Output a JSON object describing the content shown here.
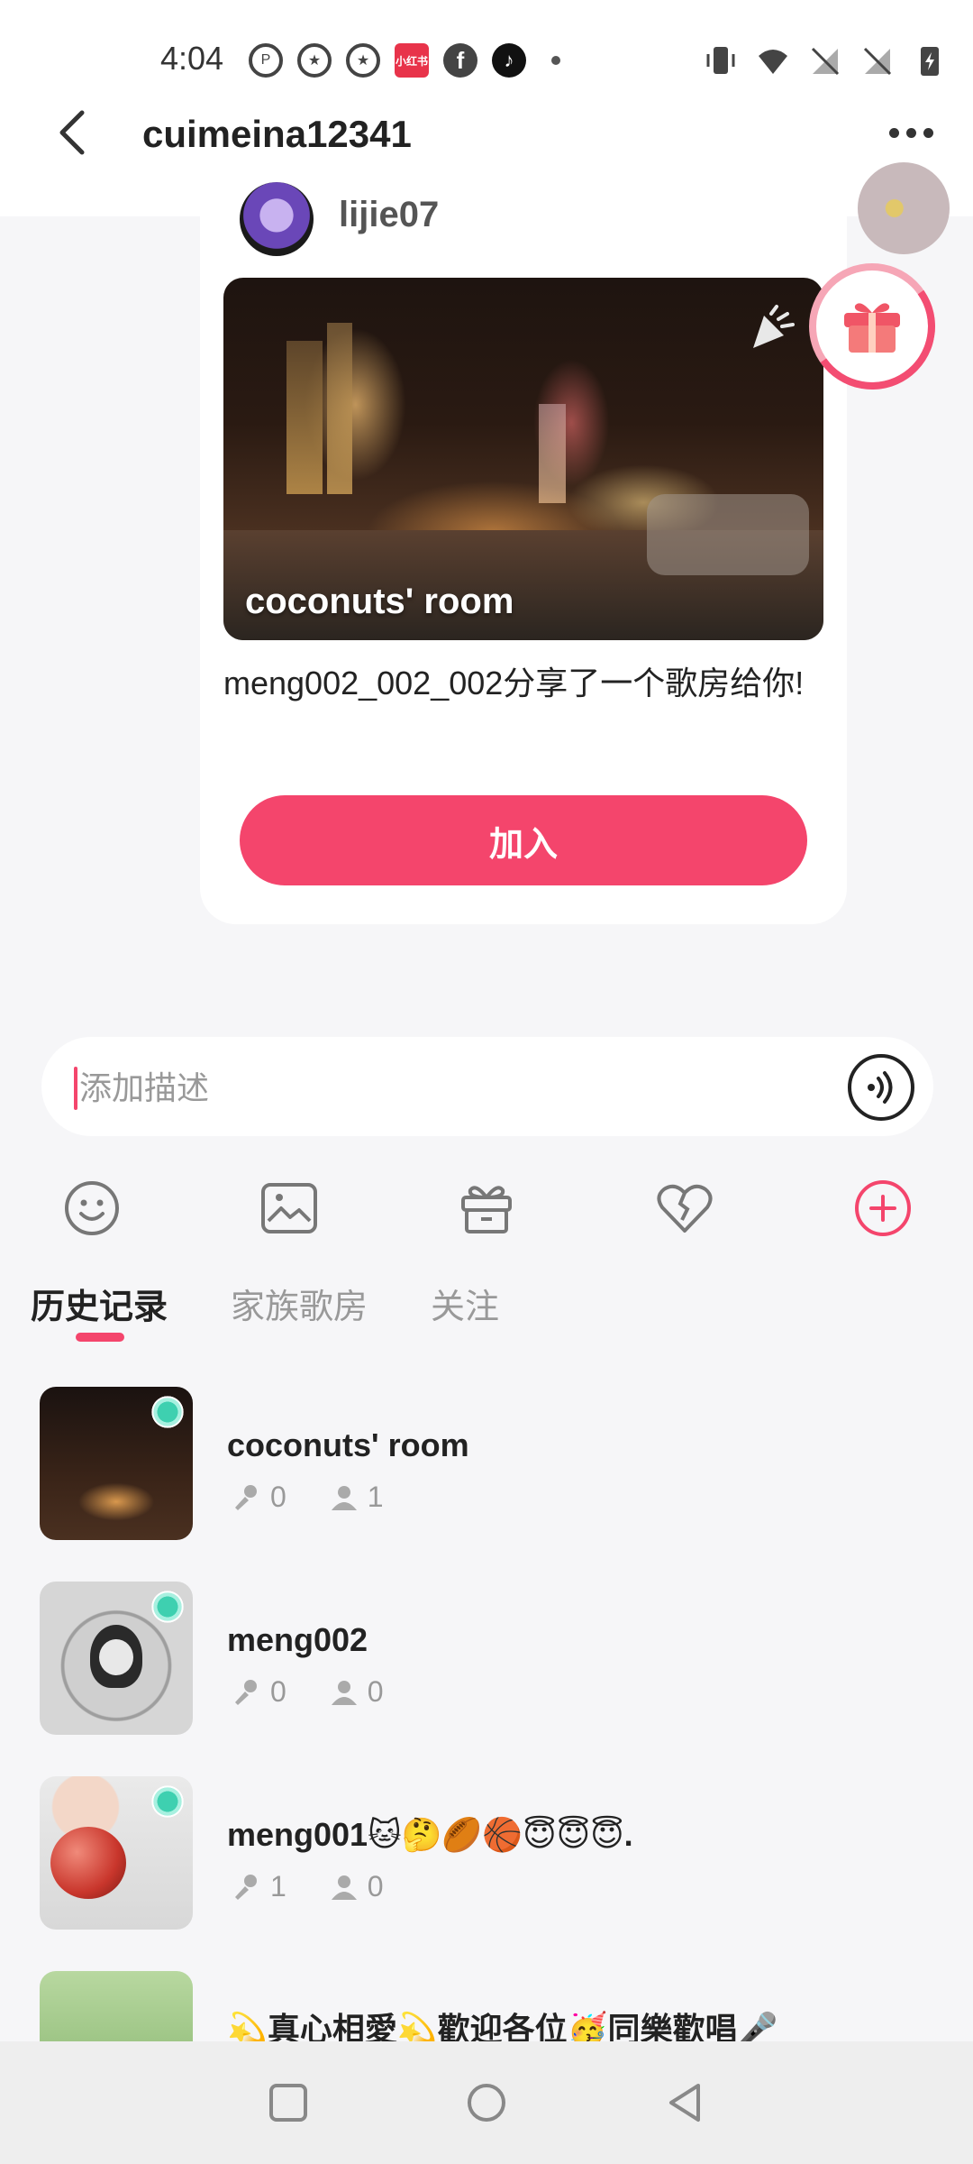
{
  "status_bar": {
    "time": "4:04",
    "notif_icons": [
      "pinterest-icon",
      "star-app-icon",
      "star-app-icon",
      "xiaohongshu-icon",
      "facebook-icon",
      "tiktok-icon"
    ],
    "xiaohongshu_label": "小红书"
  },
  "header": {
    "title": "cuimeina12341"
  },
  "message": {
    "sender": "lijie07",
    "room_title": "coconuts' room",
    "share_text": "meng002_002_002分享了一个歌房给你!",
    "join_label": "加入"
  },
  "input": {
    "placeholder": "添加描述"
  },
  "toolbar": [
    "emoji-icon",
    "image-icon",
    "gift-icon",
    "heart-icon",
    "plus-icon"
  ],
  "tabs": [
    {
      "label": "历史记录",
      "active": true
    },
    {
      "label": "家族歌房",
      "active": false
    },
    {
      "label": "关注",
      "active": false
    }
  ],
  "rooms": [
    {
      "name": "coconuts' room",
      "singers": "0",
      "listeners": "1"
    },
    {
      "name": "meng002",
      "singers": "0",
      "listeners": "0"
    },
    {
      "name": "meng001🐱🤔🏉🏀😇😇😇.",
      "singers": "1",
      "listeners": "0"
    },
    {
      "name": "💫真心相愛💫歡迎各位🥳同樂歡唱🎤",
      "singers": "",
      "listeners": ""
    }
  ],
  "colors": {
    "accent": "#f4456c",
    "background": "#f6f6f8"
  }
}
